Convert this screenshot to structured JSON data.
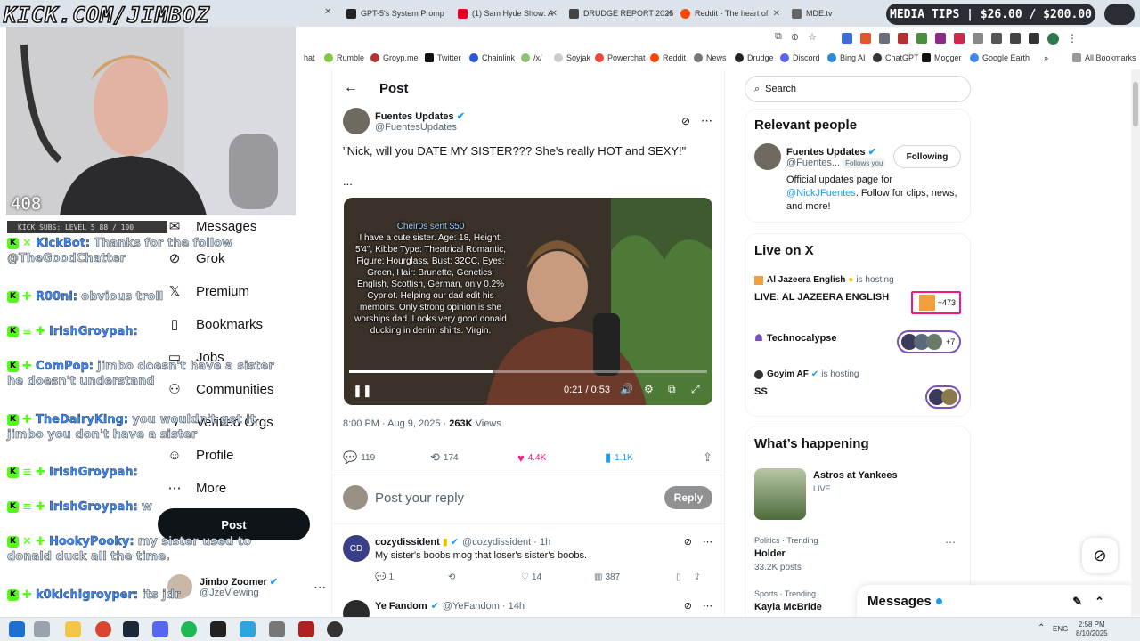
{
  "overlay": {
    "channel": "KICK.COM/JIMBOZ",
    "viewers": "408",
    "subs": "KICK SUBS: LEVEL 5 88 / 100",
    "media_tips": "MEDIA TIPS | $26.00 / $200.00"
  },
  "chat": [
    {
      "user": "KickBot:",
      "text": "Thanks for the follow",
      "cont": "@TheGoodChatter"
    },
    {
      "user": "R00ni:",
      "text": "obvious troll",
      "cont": ""
    },
    {
      "user": "IrishGroypah:",
      "text": "",
      "cont": ""
    },
    {
      "user": "ComPop:",
      "text": "jimbo doesn't have a sister",
      "cont": "he doesn't understand"
    },
    {
      "user": "TheDairyKing:",
      "text": "you wouldn't get it",
      "cont": "jimbo you don't have a sister"
    },
    {
      "user": "IrishGroypah:",
      "text": "",
      "cont": ""
    },
    {
      "user": "IrishGroypah:",
      "text": "w",
      "cont": ""
    },
    {
      "user": "HookyPooky:",
      "text": "my sister used to",
      "cont": "donald duck all the time."
    },
    {
      "user": "k0kichigroyper:",
      "text": "its jdr",
      "cont": ""
    }
  ],
  "tabs": [
    {
      "label": "GPT-5's System Promp",
      "color": "#222"
    },
    {
      "label": "(1) Sam Hyde Show: A",
      "color": "#e60023"
    },
    {
      "label": "DRUDGE REPORT 2025",
      "color": "#444"
    },
    {
      "label": "Reddit - The heart of",
      "color": "#ff4500"
    },
    {
      "label": "MDE.tv",
      "color": "#666"
    }
  ],
  "bookmarks": [
    "hat",
    "Rumble",
    "Groyp.me",
    "Twitter",
    "Chainlink",
    "/x/",
    "Soyjak",
    "Powerchat",
    "Reddit",
    "News",
    "Drudge",
    "Discord",
    "Bing AI",
    "ChatGPT",
    "Mogger",
    "Google Earth",
    "All Bookmarks"
  ],
  "nav": {
    "items": [
      "Messages",
      "Grok",
      "Premium",
      "Bookmarks",
      "Jobs",
      "Communities",
      "Verified Orgs",
      "Profile",
      "More"
    ],
    "post": "Post",
    "account_name": "Jimbo Zoomer",
    "account_handle": "@JzeViewing"
  },
  "post": {
    "header": "Post",
    "author": "Fuentes Updates",
    "handle": "@FuentesUpdates",
    "text": "\"Nick, will you DATE MY SISTER??? She's really HOT and SEXY!\"",
    "ellipsis": "...",
    "video_donor": "Cheir0s sent $50",
    "video_caption": "I have a cute sister. Age: 18, Height: 5'4\", Kibbe Type: Theatrical Romantic, Figure: Hourglass, Bust: 32CC, Eyes: Green, Hair: Brunette, Genetics: English, Scottish, German, only 0.2% Cypriot. Helping our dad edit his memoirs. Only strong opinion is she worships dad. Looks very good donald ducking in denim shirts. Virgin.",
    "video_time": "0:21 / 0:53",
    "video_progress": 0.4,
    "timestamp": "8:00 PM · Aug 9, 2025 ·",
    "views_count": "263K",
    "views_label": "Views",
    "replies": "119",
    "reposts": "174",
    "likes": "4.4K",
    "bookmarks": "1.1K",
    "reply_placeholder": "Post your reply",
    "reply_button": "Reply"
  },
  "comments": [
    {
      "name": "cozydissident",
      "handle": "@cozydissident",
      "time": "· 1h",
      "text": "My sister's boobs mog that loser's sister's boobs.",
      "replies": "1",
      "likes": "14",
      "views": "387"
    },
    {
      "name": "Ye Fandom",
      "handle": "@YeFandom",
      "time": "· 14h",
      "text": ""
    }
  ],
  "right": {
    "search_placeholder": "Search",
    "relevant_title": "Relevant people",
    "rp_name": "Fuentes Updates",
    "rp_handle": "@Fuentes...",
    "rp_follows": "Follows you",
    "rp_button": "Following",
    "rp_bio_1": "Official updates page for",
    "rp_bio_link": "@NickJFuentes",
    "rp_bio_2": ". Follow for clips, news, and more!",
    "live_title": "Live on X",
    "live": [
      {
        "host": "Al Jazeera English",
        "hosting": "is hosting",
        "title": "LIVE: AL JAZEERA ENGLISH",
        "count": "+473"
      },
      {
        "host": "Technocalypse",
        "hosting": "",
        "title": "",
        "count": "+7"
      },
      {
        "host": "Goyim AF",
        "hosting": "is hosting",
        "title": "SS",
        "count": ""
      }
    ],
    "happening_title": "What’s happening",
    "happening": [
      {
        "title": "Astros at Yankees",
        "sub": "LIVE"
      },
      {
        "context": "Politics · Trending",
        "title": "Holder",
        "sub": "33.2K posts"
      },
      {
        "context": "Sports · Trending",
        "title": "Kayla McBride",
        "sub": ""
      }
    ],
    "messages": "Messages"
  },
  "system": {
    "lang": "ENG",
    "time": "2:58 PM",
    "date": "8/10/2025"
  }
}
